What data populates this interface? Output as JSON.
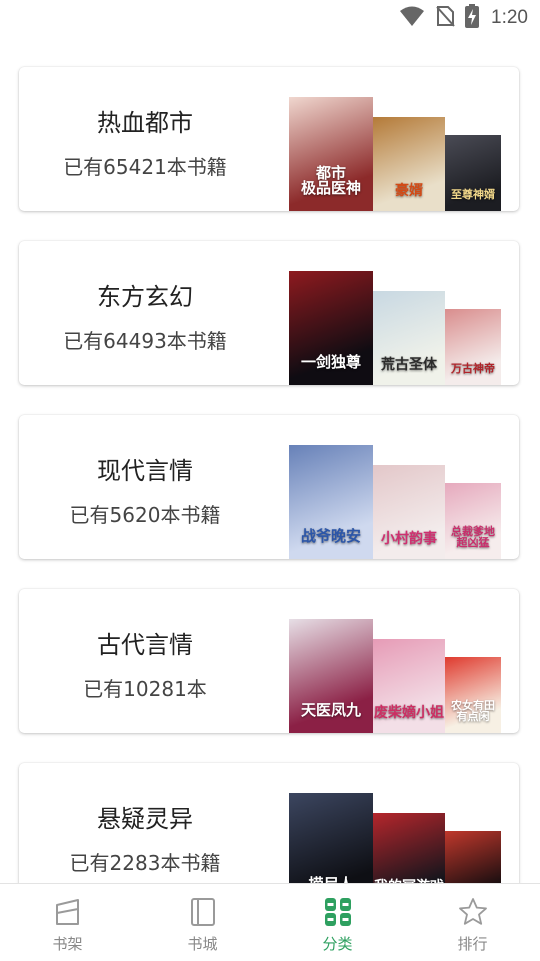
{
  "status_bar": {
    "time": "1:20",
    "icons": [
      "wifi-icon",
      "no-sim-icon",
      "battery-charging-icon"
    ]
  },
  "categories": [
    {
      "title": "热血都市",
      "count_text": "已有65421本书籍",
      "covers": [
        {
          "text": "都市\n极品医神",
          "bg": "#8c2a2a",
          "bg2": "#f0d7cf",
          "fg": "#ffffff"
        },
        {
          "text": "豪婿",
          "bg": "#e9dfc9",
          "bg2": "#b47a38",
          "fg": "#d24a16"
        },
        {
          "text": "至尊神婿",
          "bg": "#1c1d22",
          "bg2": "#4a4b55",
          "fg": "#f1d78a"
        }
      ]
    },
    {
      "title": "东方玄幻",
      "count_text": "已有64493本书籍",
      "covers": [
        {
          "text": "一剑独尊",
          "bg": "#0f0c12",
          "bg2": "#8e1a1f",
          "fg": "#ffffff"
        },
        {
          "text": "荒古圣体",
          "bg": "#f0f2ea",
          "bg2": "#c8d8e2",
          "fg": "#2b2b2b"
        },
        {
          "text": "万古神帝",
          "bg": "#f4eceb",
          "bg2": "#d98d8d",
          "fg": "#b0242a"
        }
      ]
    },
    {
      "title": "现代言情",
      "count_text": "已有5620本书籍",
      "covers": [
        {
          "text": "战爷晚安",
          "bg": "#cfd9ef",
          "bg2": "#6781b8",
          "fg": "#2c56a8"
        },
        {
          "text": "小村韵事",
          "bg": "#f3ecec",
          "bg2": "#e3c7c9",
          "fg": "#cf3070"
        },
        {
          "text": "总裁爹地\n超凶猛",
          "bg": "#f6eded",
          "bg2": "#e6a9bd",
          "fg": "#c92f6c"
        }
      ]
    },
    {
      "title": "古代言情",
      "count_text": "已有10281本",
      "covers": [
        {
          "text": "天医凤九",
          "bg": "#8b2045",
          "bg2": "#e7dfe6",
          "fg": "#ffffff"
        },
        {
          "text": "废柴嫡小姐",
          "bg": "#f3dfe7",
          "bg2": "#e69bb6",
          "fg": "#cc2f63"
        },
        {
          "text": "农女有田\n有点闲",
          "bg": "#f7f0e4",
          "bg2": "#df3a2e",
          "fg": "#ffffff"
        }
      ]
    },
    {
      "title": "悬疑灵异",
      "count_text": "已有2283本书籍",
      "covers": [
        {
          "text": "捞尸人",
          "bg": "#0e0f14",
          "bg2": "#3c4660",
          "fg": "#ffffff"
        },
        {
          "text": "我的冥游戏",
          "bg": "#16151c",
          "bg2": "#b5262c",
          "fg": "#ffffff"
        },
        {
          "text": "九幽",
          "bg": "#1a0e10",
          "bg2": "#c0382c",
          "fg": "#ffffff"
        }
      ]
    }
  ],
  "bottom_nav": [
    {
      "label": "书架",
      "icon": "bookshelf-icon",
      "active": false
    },
    {
      "label": "书城",
      "icon": "bookstore-icon",
      "active": false
    },
    {
      "label": "分类",
      "icon": "category-icon",
      "active": true
    },
    {
      "label": "排行",
      "icon": "star-icon",
      "active": false
    }
  ],
  "colors": {
    "accent": "#2ea060",
    "inactive": "#888888"
  }
}
